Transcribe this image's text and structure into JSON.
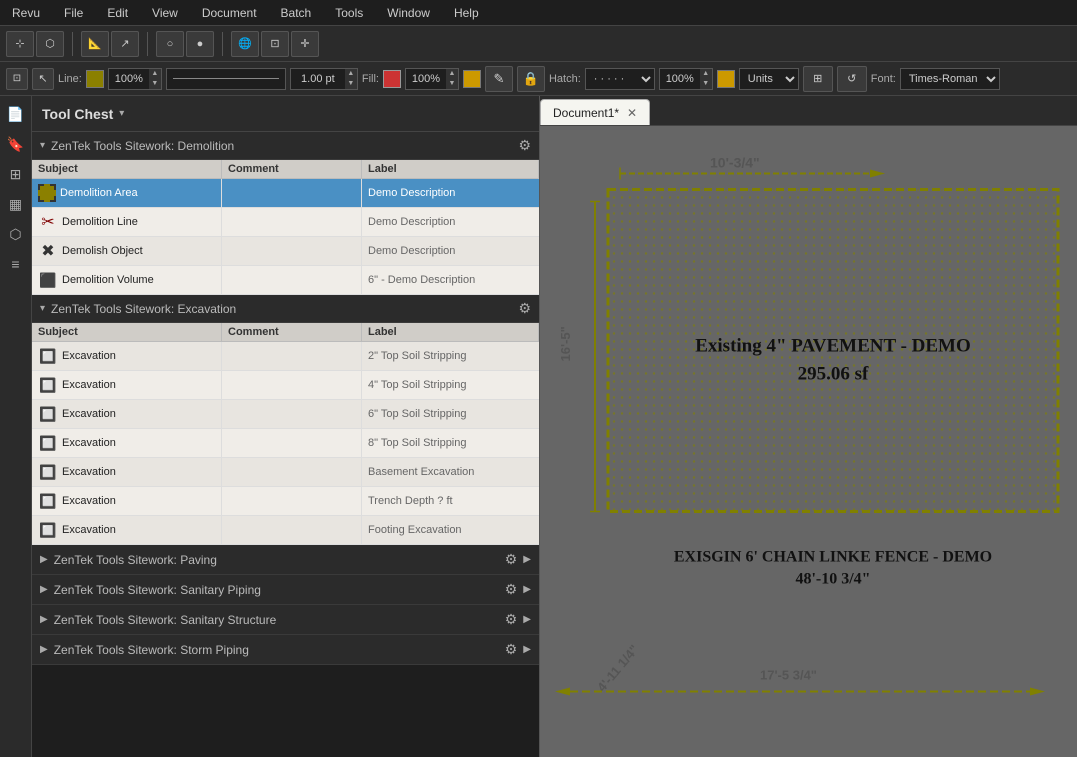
{
  "menubar": {
    "items": [
      "Revu",
      "File",
      "Edit",
      "View",
      "Document",
      "Batch",
      "Tools",
      "Window",
      "Help"
    ]
  },
  "toolbar2": {
    "line_label": "Line:",
    "line_pct": "100%",
    "line_weight": "1.00 pt",
    "fill_label": "Fill:",
    "fill_pct": "100%",
    "hatch_label": "Hatch:",
    "hatch_pct": "100%",
    "units_label": "Units",
    "font_label": "Font:",
    "font_value": "Times-Roman"
  },
  "toolchest": {
    "title": "Tool Chest",
    "sections": [
      {
        "id": "demolition",
        "name": "ZenTek Tools Sitework: Demolition",
        "expanded": true,
        "columns": [
          "Subject",
          "Comment",
          "Label"
        ],
        "rows": [
          {
            "subject": "Demolition Area",
            "comment": "",
            "label": "Demo Description",
            "selected": true
          },
          {
            "subject": "Demolition Line",
            "comment": "",
            "label": "Demo Description"
          },
          {
            "subject": "Demolish Object",
            "comment": "",
            "label": "Demo Description"
          },
          {
            "subject": "Demolition Volume",
            "comment": "",
            "label": "6\" - Demo Description"
          }
        ]
      },
      {
        "id": "excavation",
        "name": "ZenTek Tools Sitework: Excavation",
        "expanded": true,
        "columns": [
          "Subject",
          "Comment",
          "Label"
        ],
        "rows": [
          {
            "subject": "Excavation",
            "comment": "",
            "label": "2\" Top Soil Stripping"
          },
          {
            "subject": "Excavation",
            "comment": "",
            "label": "4\" Top Soil Stripping"
          },
          {
            "subject": "Excavation",
            "comment": "",
            "label": "6\" Top Soil Stripping"
          },
          {
            "subject": "Excavation",
            "comment": "",
            "label": "8\" Top Soil Stripping"
          },
          {
            "subject": "Excavation",
            "comment": "",
            "label": "Basement Excavation"
          },
          {
            "subject": "Excavation",
            "comment": "",
            "label": "Trench Depth ? ft"
          },
          {
            "subject": "Excavation",
            "comment": "",
            "label": "Footing Excavation"
          }
        ]
      }
    ],
    "collapsed_sections": [
      "ZenTek Tools Sitework: Paving",
      "ZenTek Tools Sitework: Sanitary Piping",
      "ZenTek Tools Sitework: Sanitary Structure",
      "ZenTek Tools Sitework: Storm Piping"
    ]
  },
  "document": {
    "tab_name": "Document1*"
  },
  "canvas": {
    "top_dim": "10'-3/4\"",
    "left_dim": "16'-5\"",
    "main_line1": "Existing 4\" PAVEMENT - DEMO",
    "main_line2": "295.06 sf",
    "fence_line1": "EXISGIN 6' CHAIN LINKE FENCE - DEMO",
    "fence_line2": "48'-10 3/4\"",
    "bottom_dim1": "4'-11 1/4\"",
    "bottom_dim2": "17'-5 3/4\""
  }
}
